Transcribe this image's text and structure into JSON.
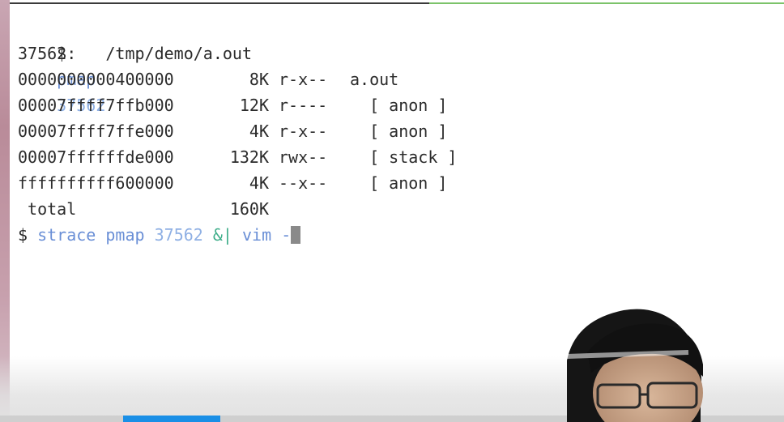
{
  "terminal": {
    "lines": [
      {
        "prompt": "$",
        "cmd": "pmap",
        "arg": "37562"
      },
      {
        "text": "37562:   /tmp/demo/a.out"
      }
    ],
    "mappings": [
      {
        "address": "0000000000400000",
        "size": "8K",
        "mode": "r-x--",
        "mapping": "a.out"
      },
      {
        "address": "00007ffff7ffb000",
        "size": "12K",
        "mode": "r----",
        "mapping": "  [ anon ]"
      },
      {
        "address": "00007ffff7ffe000",
        "size": "4K",
        "mode": "r-x--",
        "mapping": "  [ anon ]"
      },
      {
        "address": "00007ffffffde000",
        "size": "132K",
        "mode": "rwx--",
        "mapping": "  [ stack ]"
      },
      {
        "address": "ffffffffff600000",
        "size": "4K",
        "mode": "--x--",
        "mapping": "  [ anon ]"
      }
    ],
    "total_label": " total",
    "total_value": "160K",
    "last_command": {
      "prompt": "$",
      "cmd1": "strace",
      "cmd2": "pmap",
      "arg": "37562",
      "op": "&|",
      "cmd3": "vim",
      "dash": "-"
    }
  },
  "video": {
    "progress_fraction": 0.124
  },
  "colors": {
    "command": "#6a8fd6",
    "number": "#8fb0e4",
    "operator": "#3fae8a",
    "progress": "#1a8fe6"
  }
}
